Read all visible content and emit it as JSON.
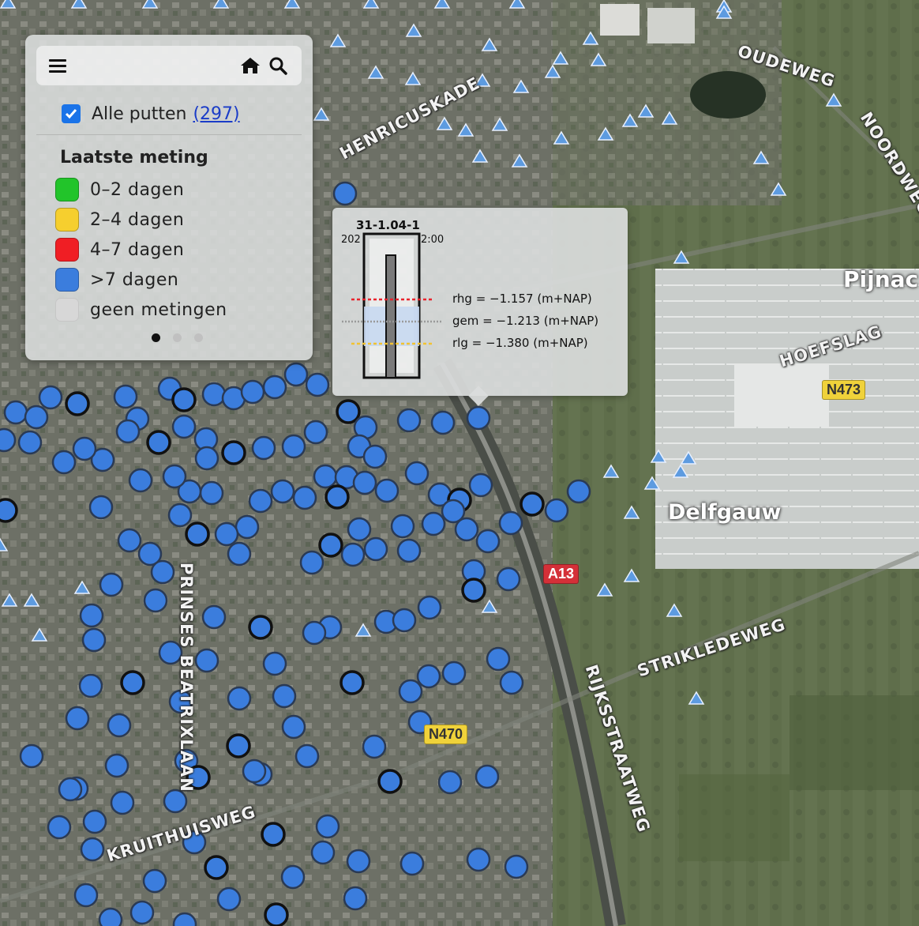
{
  "map": {
    "road_labels": [
      "HENRICUSKADE",
      "OUDEWEG",
      "NOORDWEG",
      "HOEFSLAG",
      "STRIKLEDEWEG",
      "RIJKSSTRAATWEG",
      "PRINSES BEATRIXLAAN",
      "KRUITHUISWEG"
    ],
    "place_labels": [
      "Pijnac",
      "Delfgauw"
    ],
    "shields": [
      "N473",
      "A13",
      "N470"
    ],
    "colors": {
      "well_marker": "#3b7ddd",
      "triangle_marker": "#5d9be0",
      "highway": "#d43038",
      "provincial_road": "#f0d23a"
    }
  },
  "panel": {
    "menu_icon": "hamburger-icon",
    "home_icon": "home-icon",
    "search_icon": "search-icon",
    "all_wells_label": "Alle putten",
    "all_wells_count": "(297)",
    "all_wells_checked": true,
    "legend_title": "Laatste meting",
    "legend": [
      {
        "label": "0–2 dagen",
        "color": "#22c42a"
      },
      {
        "label": "2–4 dagen",
        "color": "#f6cf2e"
      },
      {
        "label": "4–7 dagen",
        "color": "#f01e24"
      },
      {
        "label": ">7 dagen",
        "color": "#3b7ddd"
      },
      {
        "label": "geen metingen",
        "color": "#d7d7d7"
      }
    ],
    "pager": {
      "pages": 3,
      "active": 1
    }
  },
  "popup": {
    "title": "31-1.04-1",
    "date_left": "202",
    "date_right": "2:00",
    "stats": [
      {
        "label": "rhg = −1.157 (m+NAP)",
        "color": "#e8232c"
      },
      {
        "label": "gem = −1.213 (m+NAP)",
        "color": "#9a9a9a"
      },
      {
        "label": "rlg = −1.380 (m+NAP)",
        "color": "#f1c232"
      }
    ]
  }
}
